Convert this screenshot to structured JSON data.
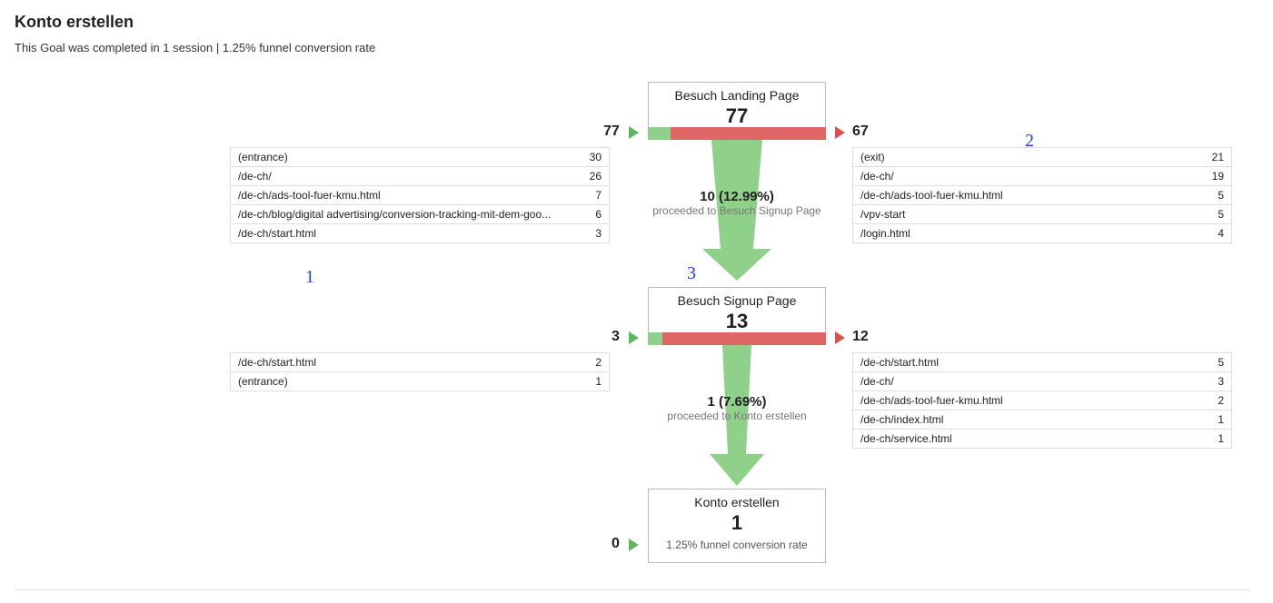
{
  "title": "Konto erstellen",
  "subtitle": "This Goal was completed in 1 session | 1.25% funnel conversion rate",
  "steps": [
    {
      "name": "Besuch Landing Page",
      "count": "77",
      "in_count": "77",
      "out_count": "67",
      "bar_green_pct": 13,
      "flow_main": "10 (12.99%)",
      "flow_sub": "proceeded to Besuch Signup Page",
      "in_table": [
        {
          "label": "(entrance)",
          "val": "30"
        },
        {
          "label": "/de-ch/",
          "val": "26"
        },
        {
          "label": "/de-ch/ads-tool-fuer-kmu.html",
          "val": "7"
        },
        {
          "label": "/de-ch/blog/digital advertising/conversion-tracking-mit-dem-goo...",
          "val": "6"
        },
        {
          "label": "/de-ch/start.html",
          "val": "3"
        }
      ],
      "out_table": [
        {
          "label": "(exit)",
          "val": "21"
        },
        {
          "label": "/de-ch/",
          "val": "19"
        },
        {
          "label": "/de-ch/ads-tool-fuer-kmu.html",
          "val": "5"
        },
        {
          "label": "/vpv-start",
          "val": "5"
        },
        {
          "label": "/login.html",
          "val": "4"
        }
      ]
    },
    {
      "name": "Besuch Signup Page",
      "count": "13",
      "in_count": "3",
      "out_count": "12",
      "bar_green_pct": 8,
      "flow_main": "1 (7.69%)",
      "flow_sub": "proceeded to Konto erstellen",
      "in_table": [
        {
          "label": "/de-ch/start.html",
          "val": "2"
        },
        {
          "label": "(entrance)",
          "val": "1"
        }
      ],
      "out_table": [
        {
          "label": "/de-ch/start.html",
          "val": "5"
        },
        {
          "label": "/de-ch/",
          "val": "3"
        },
        {
          "label": "/de-ch/ads-tool-fuer-kmu.html",
          "val": "2"
        },
        {
          "label": "/de-ch/index.html",
          "val": "1"
        },
        {
          "label": "/de-ch/service.html",
          "val": "1"
        }
      ]
    },
    {
      "name": "Konto erstellen",
      "count": "1",
      "in_count": "0",
      "footer": "1.25% funnel conversion rate"
    }
  ],
  "annotations": {
    "a1": "1",
    "a2": "2",
    "a3": "3"
  }
}
